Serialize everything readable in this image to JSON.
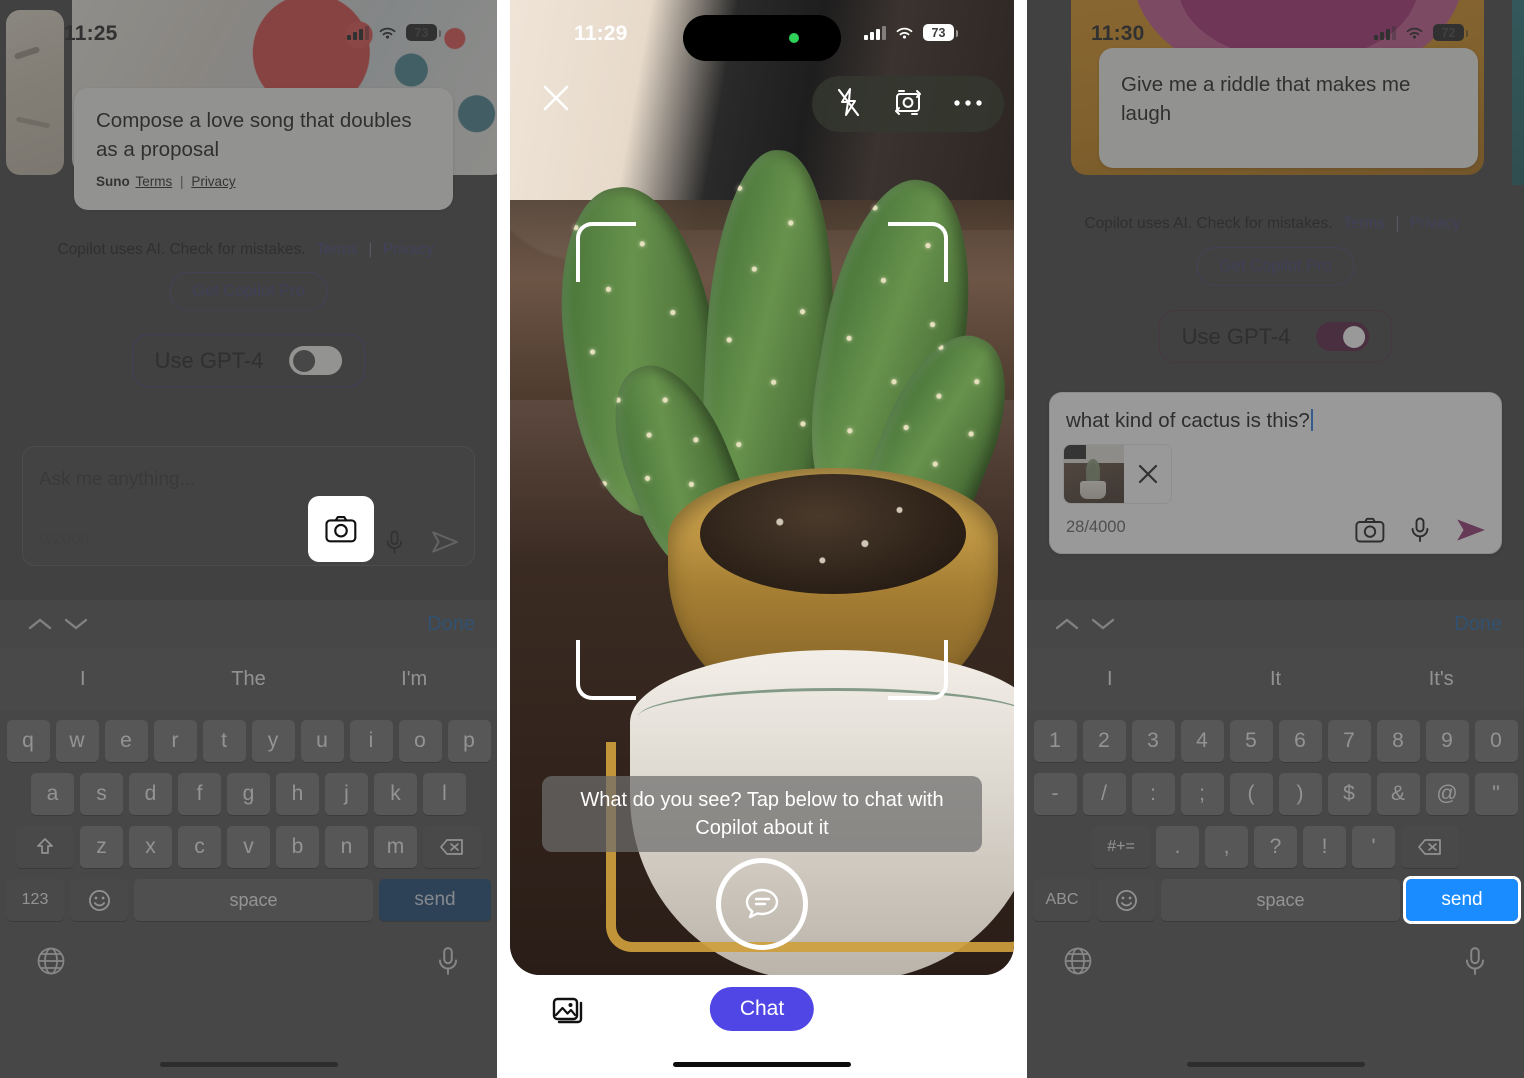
{
  "panel1": {
    "status": {
      "time": "11:25",
      "battery": "73"
    },
    "prompt_card": {
      "text": "Compose a love song that doubles as a proposal",
      "source": "Suno",
      "terms": "Terms",
      "separator": "|",
      "privacy": "Privacy"
    },
    "disclaimer": {
      "text": "Copilot uses AI. Check for mistakes.",
      "terms": "Terms",
      "divider": "|",
      "privacy": "Privacy"
    },
    "pro_button": "Get Copilot Pro",
    "gpt_toggle": {
      "label": "Use GPT-4",
      "state": "off"
    },
    "composer": {
      "placeholder": "Ask me anything...",
      "counter": "0/2000",
      "camera_icon": "camera-icon",
      "mic_icon": "microphone-icon",
      "send_icon": "send-arrow-icon"
    },
    "keyboard": {
      "done": "Done",
      "predictions": [
        "I",
        "The",
        "I'm"
      ],
      "row1": [
        "q",
        "w",
        "e",
        "r",
        "t",
        "y",
        "u",
        "i",
        "o",
        "p"
      ],
      "row2": [
        "a",
        "s",
        "d",
        "f",
        "g",
        "h",
        "j",
        "k",
        "l"
      ],
      "row3": [
        "z",
        "x",
        "c",
        "v",
        "b",
        "n",
        "m"
      ],
      "shift_icon": "shift-icon",
      "backspace_icon": "backspace-icon",
      "mode_key": "123",
      "emoji_icon": "emoji-icon",
      "space": "space",
      "send": "send",
      "globe_icon": "globe-icon",
      "dictate_icon": "microphone-icon"
    }
  },
  "panel2": {
    "status": {
      "time": "11:29",
      "battery": "73"
    },
    "close_icon": "close-x-icon",
    "tools": {
      "flash_icon": "flash-off-icon",
      "flip_icon": "flip-camera-icon",
      "more_icon": "more-ellipsis-icon"
    },
    "hint": "What do you see? Tap below to chat with Copilot about it",
    "shutter_icon": "chat-bubble-icon",
    "gallery_icon": "photo-library-icon",
    "chat_button": "Chat",
    "accent": "#4f46e5"
  },
  "panel3": {
    "status": {
      "time": "11:30",
      "battery": "72"
    },
    "prompt_card": {
      "text": "Give me a riddle that makes me laugh"
    },
    "disclaimer": {
      "text": "Copilot uses AI. Check for mistakes.",
      "terms": "Terms",
      "divider": "|",
      "privacy": "Privacy"
    },
    "pro_button": "Get Copilot Pro",
    "gpt_toggle": {
      "label": "Use GPT-4",
      "state": "on"
    },
    "composer": {
      "value": "what kind of cactus is this?",
      "counter": "28/4000",
      "attachment_remove_icon": "close-x-icon",
      "camera_icon": "camera-icon",
      "mic_icon": "microphone-icon",
      "send_icon": "send-arrow-icon"
    },
    "keyboard": {
      "done": "Done",
      "predictions": [
        "I",
        "It",
        "It's"
      ],
      "row1": [
        "1",
        "2",
        "3",
        "4",
        "5",
        "6",
        "7",
        "8",
        "9",
        "0"
      ],
      "row2": [
        "-",
        "/",
        ":",
        ";",
        "(",
        ")",
        "$",
        "&",
        "@",
        "\""
      ],
      "row3": [
        ".",
        ",",
        "?",
        "!",
        "'"
      ],
      "symbols_key": "#+=",
      "backspace_icon": "backspace-icon",
      "mode_key": "ABC",
      "emoji_icon": "emoji-icon",
      "space": "space",
      "send": "send",
      "globe_icon": "globe-icon",
      "dictate_icon": "microphone-icon"
    }
  }
}
